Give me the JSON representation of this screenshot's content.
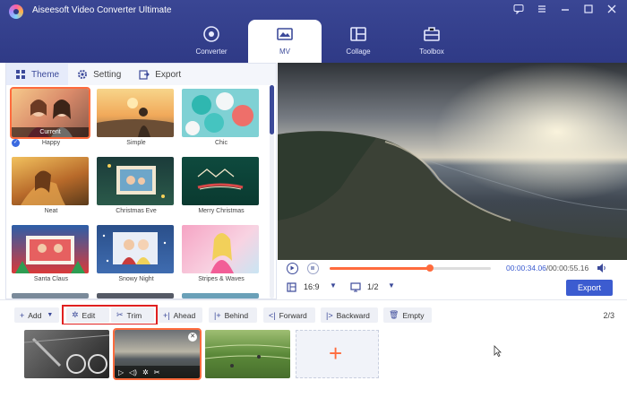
{
  "app": {
    "title": "Aiseesoft Video Converter Ultimate",
    "window_controls": [
      "feedback-icon",
      "menu-icon",
      "minimize-icon",
      "maximize-icon",
      "close-icon"
    ]
  },
  "nav": {
    "tabs": [
      {
        "label": "Converter",
        "icon": "converter-icon",
        "active": false
      },
      {
        "label": "MV",
        "icon": "mv-icon",
        "active": true
      },
      {
        "label": "Collage",
        "icon": "collage-icon",
        "active": false
      },
      {
        "label": "Toolbox",
        "icon": "toolbox-icon",
        "active": false
      }
    ]
  },
  "subtabs": {
    "theme": "Theme",
    "setting": "Setting",
    "export": "Export"
  },
  "themes": {
    "current_label": "Current",
    "items": [
      {
        "name": "Happy",
        "selected": true
      },
      {
        "name": "Simple",
        "selected": false
      },
      {
        "name": "Chic",
        "selected": false
      },
      {
        "name": "Neat",
        "selected": false
      },
      {
        "name": "Christmas Eve",
        "selected": false
      },
      {
        "name": "Merry Christmas",
        "selected": false
      },
      {
        "name": "Santa Claus",
        "selected": false
      },
      {
        "name": "Snowy Night",
        "selected": false
      },
      {
        "name": "Stripes & Waves",
        "selected": false
      }
    ]
  },
  "player": {
    "current_time": "00:00:34.06",
    "separator": "/",
    "total_time": "00:00:55.16",
    "progress_fraction": 0.62,
    "aspect_ratio": "16:9",
    "page": "1/2",
    "export_label": "Export"
  },
  "toolbar": {
    "add": "Add",
    "edit": "Edit",
    "trim": "Trim",
    "ahead": "Ahead",
    "behind": "Behind",
    "forward": "Forward",
    "backward": "Backward",
    "empty": "Empty",
    "count": "2/3"
  },
  "timeline": {
    "add_clip_symbol": "+"
  },
  "colors": {
    "accent": "#3c5cd0",
    "highlight": "#ff6b3d",
    "titlebar": "#3a4694",
    "annotation_box": "#e02020"
  }
}
